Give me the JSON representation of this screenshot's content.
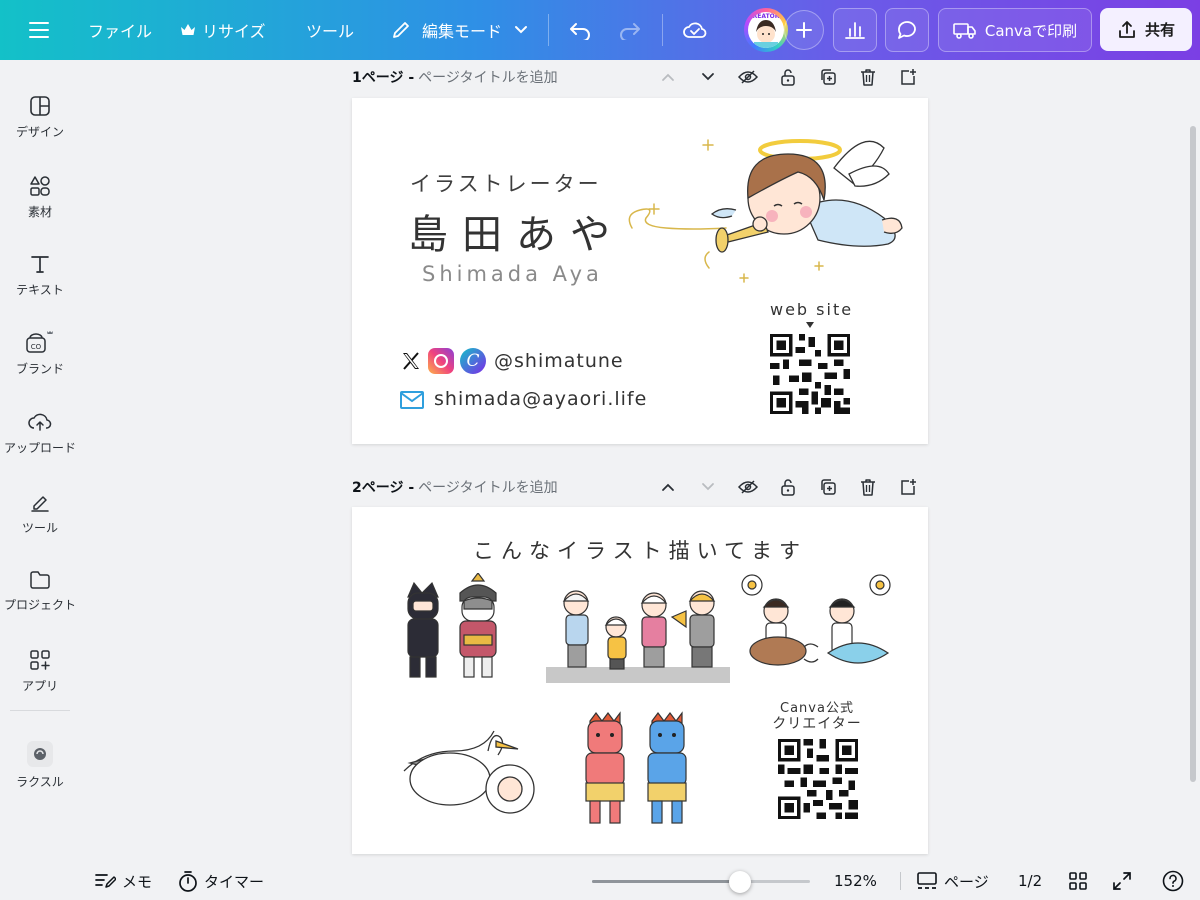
{
  "topbar": {
    "file": "ファイル",
    "resize": "リサイズ",
    "tools": "ツール",
    "edit_mode": "編集モード",
    "print": "Canvaで印刷",
    "share": "共有",
    "avatar_badge": "CREATORS"
  },
  "sidebar": {
    "items": [
      {
        "label": "デザイン",
        "icon": "design-icon"
      },
      {
        "label": "素材",
        "icon": "elements-icon"
      },
      {
        "label": "テキスト",
        "icon": "text-icon"
      },
      {
        "label": "ブランド",
        "icon": "brand-icon"
      },
      {
        "label": "アップロード",
        "icon": "upload-icon"
      },
      {
        "label": "ツール",
        "icon": "tools-icon"
      },
      {
        "label": "プロジェクト",
        "icon": "folder-icon"
      },
      {
        "label": "アプリ",
        "icon": "apps-icon"
      },
      {
        "label": "ラクスル",
        "icon": "raksul-icon"
      }
    ]
  },
  "pages": [
    {
      "number": "1ページ -",
      "title": "ページタイトルを追加"
    },
    {
      "number": "2ページ -",
      "title": "ページタイトルを追加"
    }
  ],
  "card1": {
    "role": "イラストレーター",
    "name": "島田あや",
    "romaji": "Shimada Aya",
    "handle": "@shimatune",
    "email": "shimada@ayaori.life",
    "website_label": "web site"
  },
  "card2": {
    "heading": "こんなイラスト描いてます",
    "canva_label_1": "Canva公式",
    "canva_label_2": "クリエイター"
  },
  "bottombar": {
    "memo": "メモ",
    "timer": "タイマー",
    "zoom": "152%",
    "zoom_fraction": 0.68,
    "pages": "ページ",
    "page_count": "1/2"
  },
  "colors": {
    "accent": "#7d2ae8",
    "teal": "#13c1c8",
    "oni_red": "#f07a7a",
    "oni_blue": "#5aa4e8"
  }
}
